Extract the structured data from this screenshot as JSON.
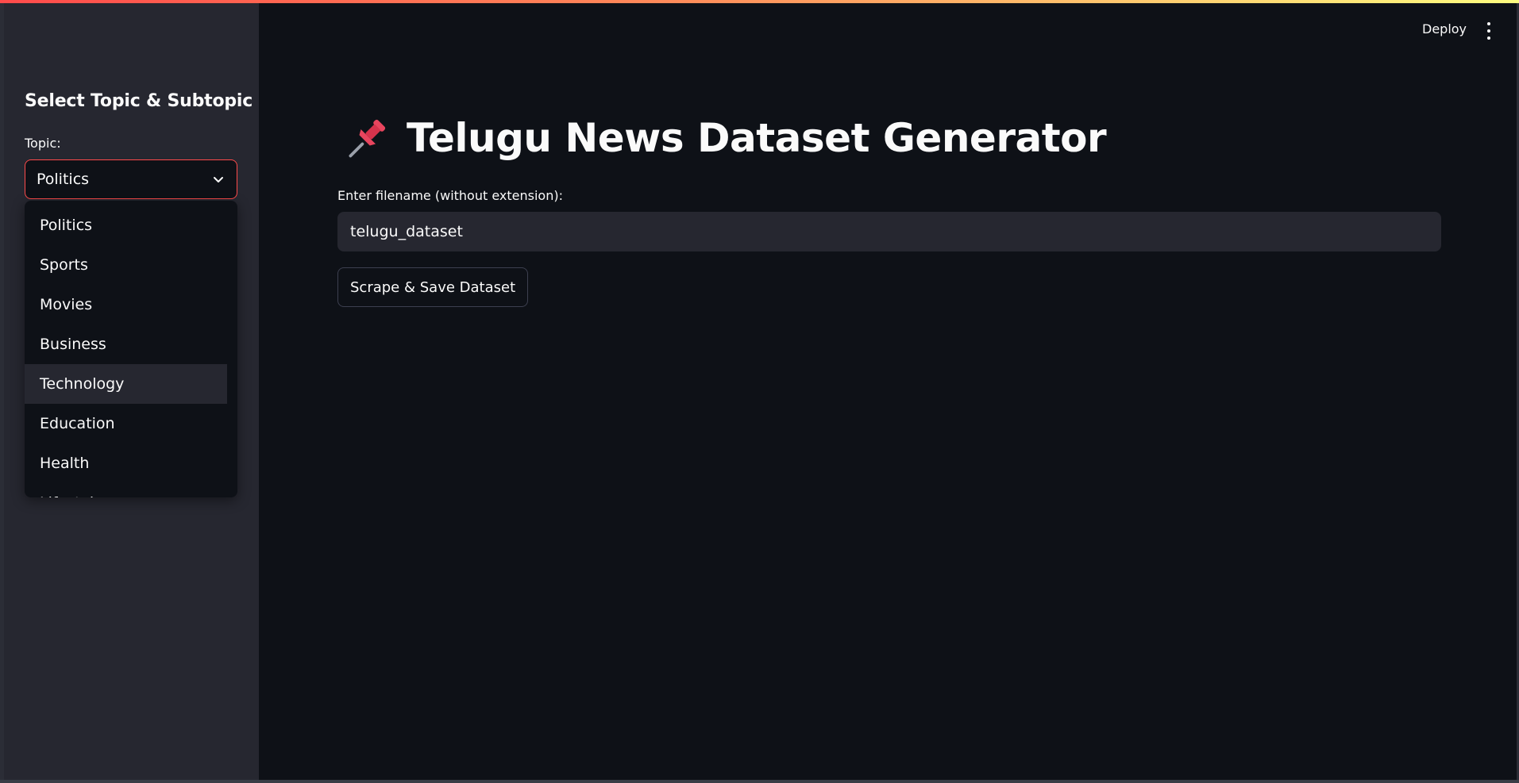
{
  "colors": {
    "background": "#0e1117",
    "sidebar": "#262730",
    "accent": "#ff4b4b",
    "text": "#fafafa"
  },
  "header": {
    "deploy_label": "Deploy",
    "menu_icon": "kebab-menu-icon"
  },
  "sidebar": {
    "title": "Select Topic & Subtopic",
    "topic_label": "Topic:",
    "topic_value": "Politics",
    "dropdown_options": [
      "Politics",
      "Sports",
      "Movies",
      "Business",
      "Technology",
      "Education",
      "Health",
      "Lifestyle"
    ],
    "highlighted_option": "Technology"
  },
  "main": {
    "title_icon": "pushpin-icon",
    "title": "Telugu News Dataset Generator",
    "filename_label": "Enter filename (without extension):",
    "filename_value": "telugu_dataset",
    "scrape_button_label": "Scrape & Save Dataset"
  }
}
